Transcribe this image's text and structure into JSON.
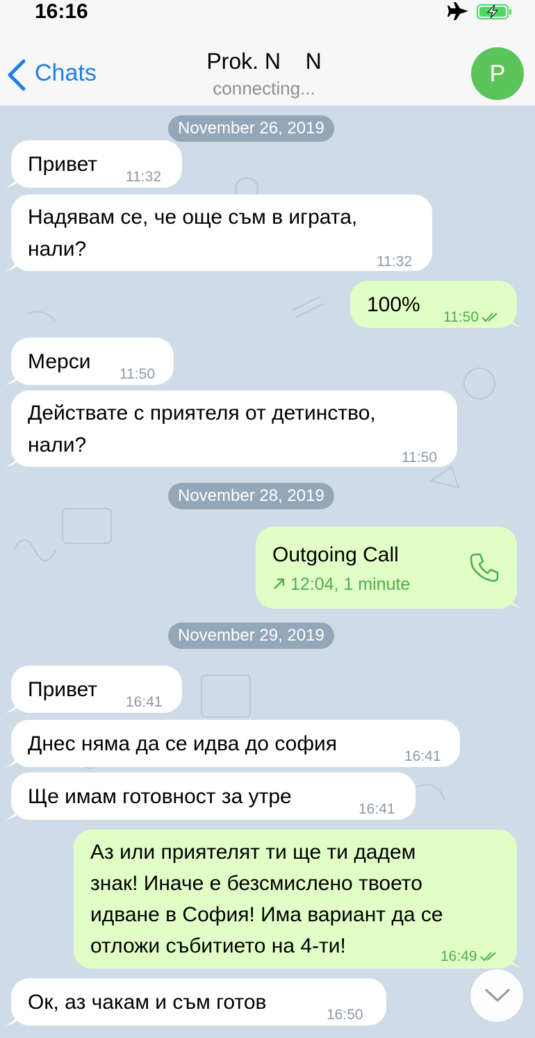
{
  "status_bar": {
    "time": "16:16",
    "airplane_icon": "airplane-icon",
    "battery_icon": "battery-charging-icon"
  },
  "header": {
    "back_label": "Chats",
    "title": "Prok. N    N",
    "subtitle": "connecting...",
    "avatar_initial": "P",
    "avatar_color": "#5cc45b"
  },
  "colors": {
    "accent": "#1f7ee8",
    "incoming_bubble": "#ffffff",
    "outgoing_bubble": "#e1fec7",
    "chat_background": "#cfdbe7",
    "outgoing_time": "#4fae4e"
  },
  "dates": [
    "November 26, 2019",
    "November 28, 2019",
    "November 29, 2019"
  ],
  "messages": [
    {
      "dir": "in",
      "text": "Привет",
      "time": "11:32"
    },
    {
      "dir": "in",
      "lines": [
        "Надявам се, че още съм в играта,",
        "нали?"
      ],
      "time": "11:32"
    },
    {
      "dir": "out",
      "text": "100%",
      "time": "11:50",
      "read": true
    },
    {
      "dir": "in",
      "text": "Мерси",
      "time": "11:50"
    },
    {
      "dir": "in",
      "lines": [
        "Действате с приятеля от детинство,",
        "нали?"
      ],
      "time": "11:50"
    },
    {
      "dir": "out",
      "type": "call",
      "title": "Outgoing Call",
      "detail": "12:04, 1 minute",
      "call_icon": "phone-icon",
      "direction_icon": "arrow-up-right-icon"
    },
    {
      "dir": "in",
      "text": "Привет",
      "time": "16:41"
    },
    {
      "dir": "in",
      "text": "Днес няма да се идва до софия",
      "time": "16:41"
    },
    {
      "dir": "in",
      "text": "Ще имам готовност за утре",
      "time": "16:41"
    },
    {
      "dir": "out",
      "lines": [
        "Аз или приятелят ти ще ти дадем",
        "знак! Иначе е безсмислено твоето",
        "идване в София! Има вариант да се",
        "отложи събитието на 4-ти!"
      ],
      "time": "16:49",
      "read": true
    },
    {
      "dir": "in",
      "text": "Ок, аз чакам и съм готов",
      "time": "16:50"
    }
  ],
  "scroll_down_icon": "chevron-down-icon"
}
